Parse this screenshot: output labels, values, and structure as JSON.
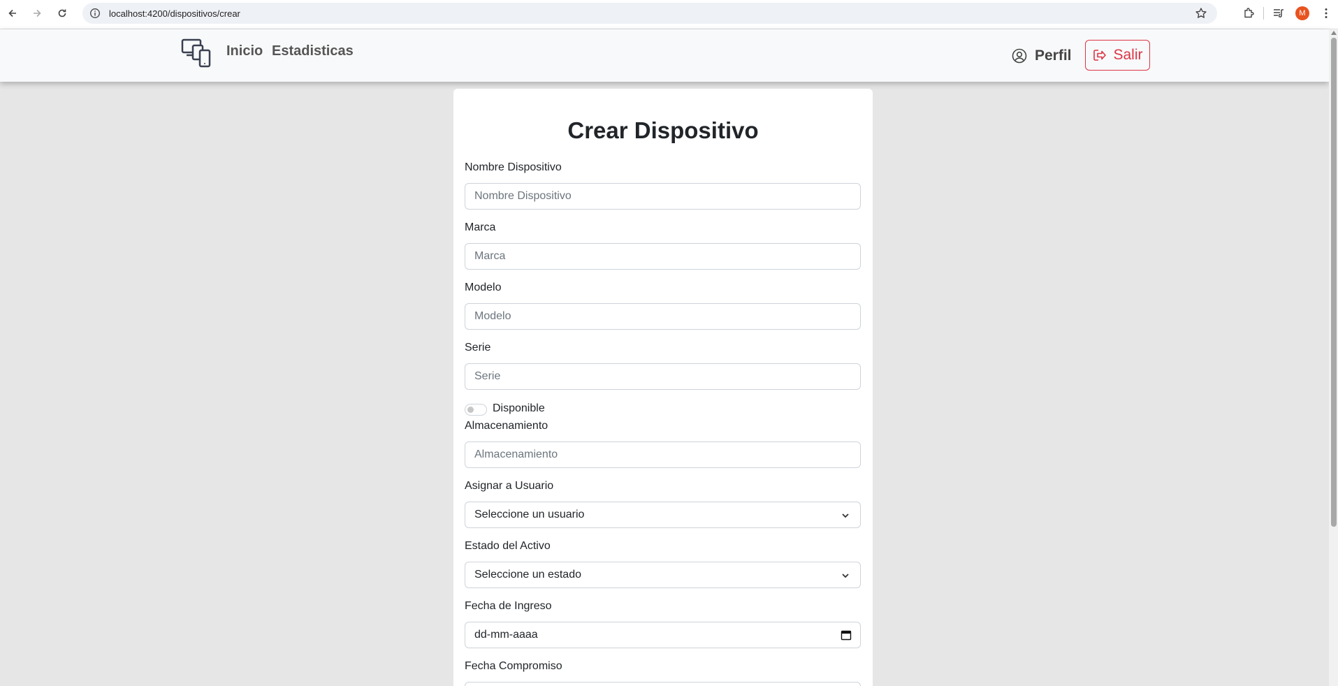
{
  "browser": {
    "url": "localhost:4200/dispositivos/crear",
    "profile_initial": "M"
  },
  "navbar": {
    "inicio": "Inicio",
    "estadisticas": "Estadisticas",
    "perfil": "Perfil",
    "salir": "Salir"
  },
  "form": {
    "title": "Crear Dispositivo",
    "nombre": {
      "label": "Nombre Dispositivo",
      "placeholder": "Nombre Dispositivo"
    },
    "marca": {
      "label": "Marca",
      "placeholder": "Marca"
    },
    "modelo": {
      "label": "Modelo",
      "placeholder": "Modelo"
    },
    "serie": {
      "label": "Serie",
      "placeholder": "Serie"
    },
    "disponible": {
      "label": "Disponible",
      "checked": false
    },
    "almacenamiento": {
      "label": "Almacenamiento",
      "placeholder": "Almacenamiento"
    },
    "usuario": {
      "label": "Asignar a Usuario",
      "selected": "Seleccione un usuario"
    },
    "estado": {
      "label": "Estado del Activo",
      "selected": "Seleccione un estado"
    },
    "fecha_ingreso": {
      "label": "Fecha de Ingreso",
      "value": "dd-mm-aaaa"
    },
    "fecha_compromiso": {
      "label": "Fecha Compromiso"
    }
  },
  "colors": {
    "danger": "#dc3545",
    "page_bg": "#e6e6e6",
    "navbar_bg": "#f8f9fa"
  }
}
